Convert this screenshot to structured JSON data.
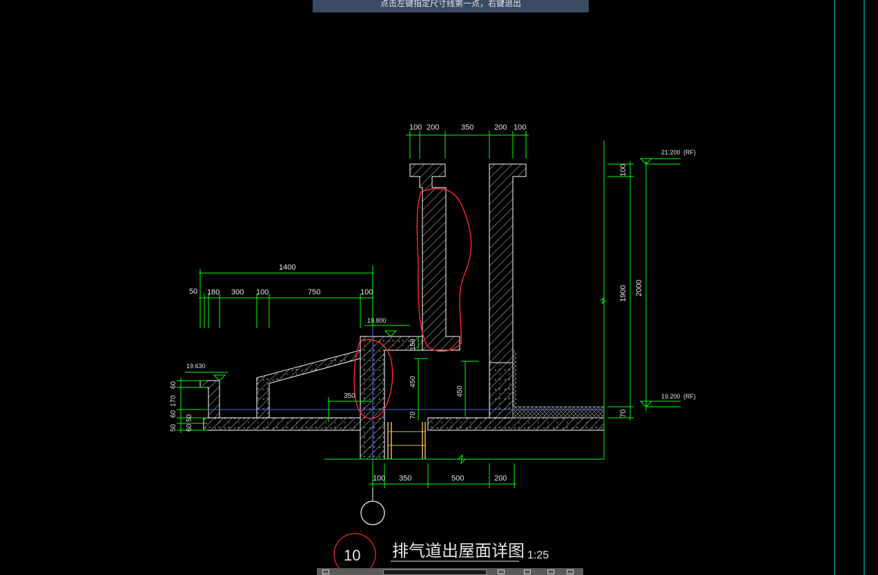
{
  "command_prompt": "点击左键指定尺寸线第一点，右键退出",
  "drawing": {
    "title": "排气道出屋面详图",
    "scale": "1:25",
    "detail_number": "10",
    "top_dims": [
      "100",
      "200",
      "350",
      "200",
      "100"
    ],
    "left_overall_dim": "1400",
    "left_dims": [
      "50",
      "180",
      "300",
      "100",
      "750",
      "100"
    ],
    "bottom_dims": [
      "100",
      "350",
      "500",
      "200"
    ],
    "right_dims": {
      "top": "100",
      "middle": "1900",
      "overall": "2000",
      "bottom": "70"
    },
    "elevations": {
      "top": "21.200",
      "bottom": "19.200",
      "mid": "19.800",
      "left": "19.630"
    },
    "elevation_tags": [
      "(RF)",
      "(RF)"
    ],
    "vertical_dims_left": [
      "60",
      "170",
      "60",
      "50",
      "60",
      "50"
    ],
    "inner_dims": {
      "d150": "150",
      "d450a": "450",
      "d450b": "450",
      "d350": "350",
      "d70": "70"
    }
  },
  "colors": {
    "background": "#000000",
    "dimension": "#00ff00",
    "linework": "#ffffff",
    "markup": "#ff2a2a",
    "edge_line": "#00e5e5",
    "prompt_bg": "#3a4a63"
  }
}
